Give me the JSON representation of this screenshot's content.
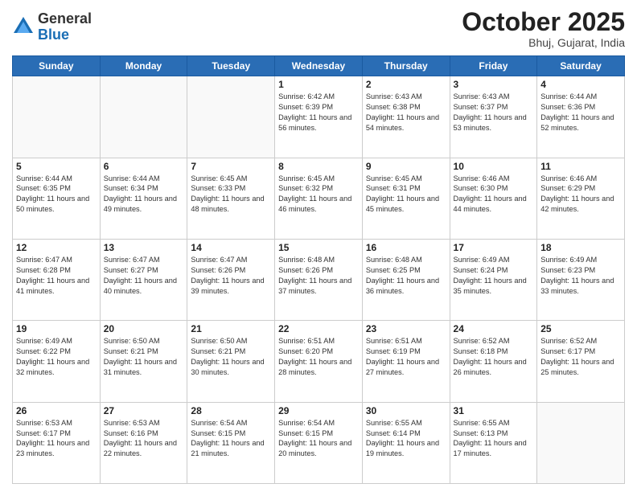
{
  "header": {
    "logo_general": "General",
    "logo_blue": "Blue",
    "month_title": "October 2025",
    "location": "Bhuj, Gujarat, India"
  },
  "calendar": {
    "days_of_week": [
      "Sunday",
      "Monday",
      "Tuesday",
      "Wednesday",
      "Thursday",
      "Friday",
      "Saturday"
    ],
    "weeks": [
      [
        {
          "day": "",
          "info": ""
        },
        {
          "day": "",
          "info": ""
        },
        {
          "day": "",
          "info": ""
        },
        {
          "day": "1",
          "info": "Sunrise: 6:42 AM\nSunset: 6:39 PM\nDaylight: 11 hours\nand 56 minutes."
        },
        {
          "day": "2",
          "info": "Sunrise: 6:43 AM\nSunset: 6:38 PM\nDaylight: 11 hours\nand 54 minutes."
        },
        {
          "day": "3",
          "info": "Sunrise: 6:43 AM\nSunset: 6:37 PM\nDaylight: 11 hours\nand 53 minutes."
        },
        {
          "day": "4",
          "info": "Sunrise: 6:44 AM\nSunset: 6:36 PM\nDaylight: 11 hours\nand 52 minutes."
        }
      ],
      [
        {
          "day": "5",
          "info": "Sunrise: 6:44 AM\nSunset: 6:35 PM\nDaylight: 11 hours\nand 50 minutes."
        },
        {
          "day": "6",
          "info": "Sunrise: 6:44 AM\nSunset: 6:34 PM\nDaylight: 11 hours\nand 49 minutes."
        },
        {
          "day": "7",
          "info": "Sunrise: 6:45 AM\nSunset: 6:33 PM\nDaylight: 11 hours\nand 48 minutes."
        },
        {
          "day": "8",
          "info": "Sunrise: 6:45 AM\nSunset: 6:32 PM\nDaylight: 11 hours\nand 46 minutes."
        },
        {
          "day": "9",
          "info": "Sunrise: 6:45 AM\nSunset: 6:31 PM\nDaylight: 11 hours\nand 45 minutes."
        },
        {
          "day": "10",
          "info": "Sunrise: 6:46 AM\nSunset: 6:30 PM\nDaylight: 11 hours\nand 44 minutes."
        },
        {
          "day": "11",
          "info": "Sunrise: 6:46 AM\nSunset: 6:29 PM\nDaylight: 11 hours\nand 42 minutes."
        }
      ],
      [
        {
          "day": "12",
          "info": "Sunrise: 6:47 AM\nSunset: 6:28 PM\nDaylight: 11 hours\nand 41 minutes."
        },
        {
          "day": "13",
          "info": "Sunrise: 6:47 AM\nSunset: 6:27 PM\nDaylight: 11 hours\nand 40 minutes."
        },
        {
          "day": "14",
          "info": "Sunrise: 6:47 AM\nSunset: 6:26 PM\nDaylight: 11 hours\nand 39 minutes."
        },
        {
          "day": "15",
          "info": "Sunrise: 6:48 AM\nSunset: 6:26 PM\nDaylight: 11 hours\nand 37 minutes."
        },
        {
          "day": "16",
          "info": "Sunrise: 6:48 AM\nSunset: 6:25 PM\nDaylight: 11 hours\nand 36 minutes."
        },
        {
          "day": "17",
          "info": "Sunrise: 6:49 AM\nSunset: 6:24 PM\nDaylight: 11 hours\nand 35 minutes."
        },
        {
          "day": "18",
          "info": "Sunrise: 6:49 AM\nSunset: 6:23 PM\nDaylight: 11 hours\nand 33 minutes."
        }
      ],
      [
        {
          "day": "19",
          "info": "Sunrise: 6:49 AM\nSunset: 6:22 PM\nDaylight: 11 hours\nand 32 minutes."
        },
        {
          "day": "20",
          "info": "Sunrise: 6:50 AM\nSunset: 6:21 PM\nDaylight: 11 hours\nand 31 minutes."
        },
        {
          "day": "21",
          "info": "Sunrise: 6:50 AM\nSunset: 6:21 PM\nDaylight: 11 hours\nand 30 minutes."
        },
        {
          "day": "22",
          "info": "Sunrise: 6:51 AM\nSunset: 6:20 PM\nDaylight: 11 hours\nand 28 minutes."
        },
        {
          "day": "23",
          "info": "Sunrise: 6:51 AM\nSunset: 6:19 PM\nDaylight: 11 hours\nand 27 minutes."
        },
        {
          "day": "24",
          "info": "Sunrise: 6:52 AM\nSunset: 6:18 PM\nDaylight: 11 hours\nand 26 minutes."
        },
        {
          "day": "25",
          "info": "Sunrise: 6:52 AM\nSunset: 6:17 PM\nDaylight: 11 hours\nand 25 minutes."
        }
      ],
      [
        {
          "day": "26",
          "info": "Sunrise: 6:53 AM\nSunset: 6:17 PM\nDaylight: 11 hours\nand 23 minutes."
        },
        {
          "day": "27",
          "info": "Sunrise: 6:53 AM\nSunset: 6:16 PM\nDaylight: 11 hours\nand 22 minutes."
        },
        {
          "day": "28",
          "info": "Sunrise: 6:54 AM\nSunset: 6:15 PM\nDaylight: 11 hours\nand 21 minutes."
        },
        {
          "day": "29",
          "info": "Sunrise: 6:54 AM\nSunset: 6:15 PM\nDaylight: 11 hours\nand 20 minutes."
        },
        {
          "day": "30",
          "info": "Sunrise: 6:55 AM\nSunset: 6:14 PM\nDaylight: 11 hours\nand 19 minutes."
        },
        {
          "day": "31",
          "info": "Sunrise: 6:55 AM\nSunset: 6:13 PM\nDaylight: 11 hours\nand 17 minutes."
        },
        {
          "day": "",
          "info": ""
        }
      ]
    ]
  }
}
